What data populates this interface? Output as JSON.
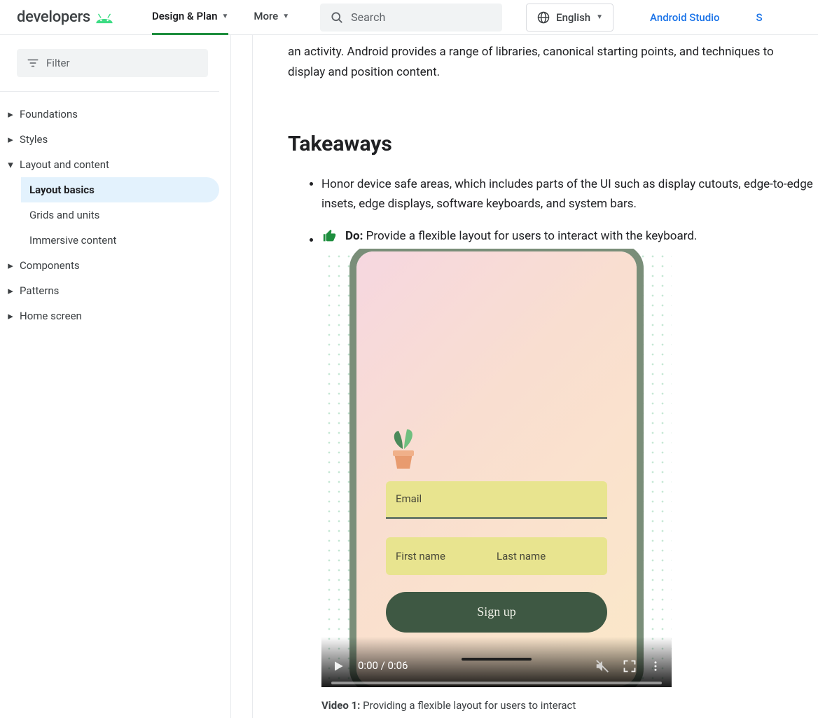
{
  "header": {
    "logo_text": "developers",
    "tabs": {
      "design": "Design & Plan",
      "more": "More"
    },
    "search_placeholder": "Search",
    "language": "English",
    "studio": "Android Studio",
    "cutoff": "S"
  },
  "sidebar": {
    "filter_placeholder": "Filter",
    "items": {
      "foundations": "Foundations",
      "styles": "Styles",
      "layout": "Layout and content",
      "components": "Components",
      "patterns": "Patterns",
      "homescreen": "Home screen"
    },
    "layout_children": {
      "basics": "Layout basics",
      "grids": "Grids and units",
      "immersive": "Immersive content"
    }
  },
  "content": {
    "intro": "an activity. Android provides a range of libraries, canonical starting points, and techniques to display and position content.",
    "heading": "Takeaways",
    "bullet1": "Honor device safe areas, which includes parts of the UI such as display cutouts, edge-to-edge insets, edge displays, software keyboards, and system bars.",
    "do_label": "Do:",
    "bullet2_text": " Provide a flexible layout for users to interact with the keyboard.",
    "video": {
      "fields": {
        "email": "Email",
        "first": "First name",
        "last": "Last name"
      },
      "signup": "Sign up",
      "time": "0:00 / 0:06",
      "caption_label": "Video 1:",
      "caption_text": " Providing a flexible layout for users to interact"
    }
  }
}
